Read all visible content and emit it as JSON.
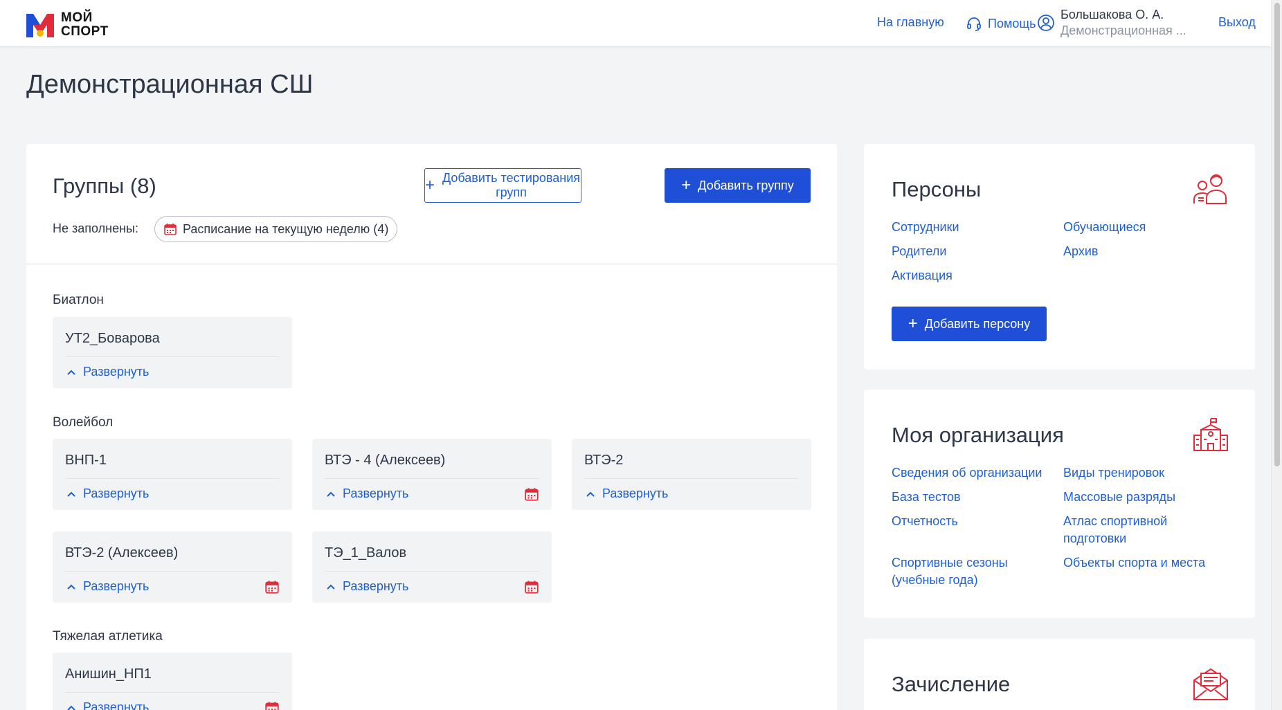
{
  "header": {
    "logo_line1": "МОЙ",
    "logo_line2": "СПОРТ",
    "home_link": "На главную",
    "help_link": "Помощь",
    "user_name": "Большакова О. А.",
    "user_org": "Демонстрационная ...",
    "logout_link": "Выход"
  },
  "page": {
    "title": "Демонстрационная СШ"
  },
  "groups": {
    "title": "Группы (8)",
    "add_testing_button": "Добавить тестирования групп",
    "add_group_button": "Добавить группу",
    "unfilled_label": "Не заполнены:",
    "unfilled_chip": "Расписание на текущую неделю (4)",
    "sports": [
      {
        "name": "Биатлон"
      },
      {
        "name": "Волейбол"
      },
      {
        "name": "Тяжелая атлетика"
      }
    ],
    "cards": [
      {
        "name": "УТ2_Боварова",
        "expand": "Развернуть"
      },
      {
        "name": "ВНП-1",
        "expand": "Развернуть"
      },
      {
        "name": "ВТЭ - 4 (Алексеев)",
        "expand": "Развернуть"
      },
      {
        "name": "ВТЭ-2",
        "expand": "Развернуть"
      },
      {
        "name": "ВТЭ-2 (Алексеев)",
        "expand": "Развернуть"
      },
      {
        "name": "ТЭ_1_Валов",
        "expand": "Развернуть"
      },
      {
        "name": "Анишин_НП1",
        "expand": "Развернуть"
      }
    ]
  },
  "persons": {
    "title": "Персоны",
    "links": [
      "Сотрудники",
      "Обучающиеся",
      "Родители",
      "Архив",
      "Активация"
    ],
    "add_button": "Добавить персону"
  },
  "organization": {
    "title": "Моя организация",
    "links": [
      "Сведения об организации",
      "Виды тренировок",
      "База тестов",
      "Массовые разряды",
      "Отчетность",
      "Атлас спортивной подготовки",
      "Спортивные сезоны (учебные года)",
      "Объекты спорта и места"
    ]
  },
  "enrollment": {
    "title": "Зачисление"
  },
  "colors": {
    "accent": "#1f4fd6",
    "link": "#1f5fd1",
    "icon_red": "#e02d3c",
    "page_bg": "#f3f4f6"
  }
}
